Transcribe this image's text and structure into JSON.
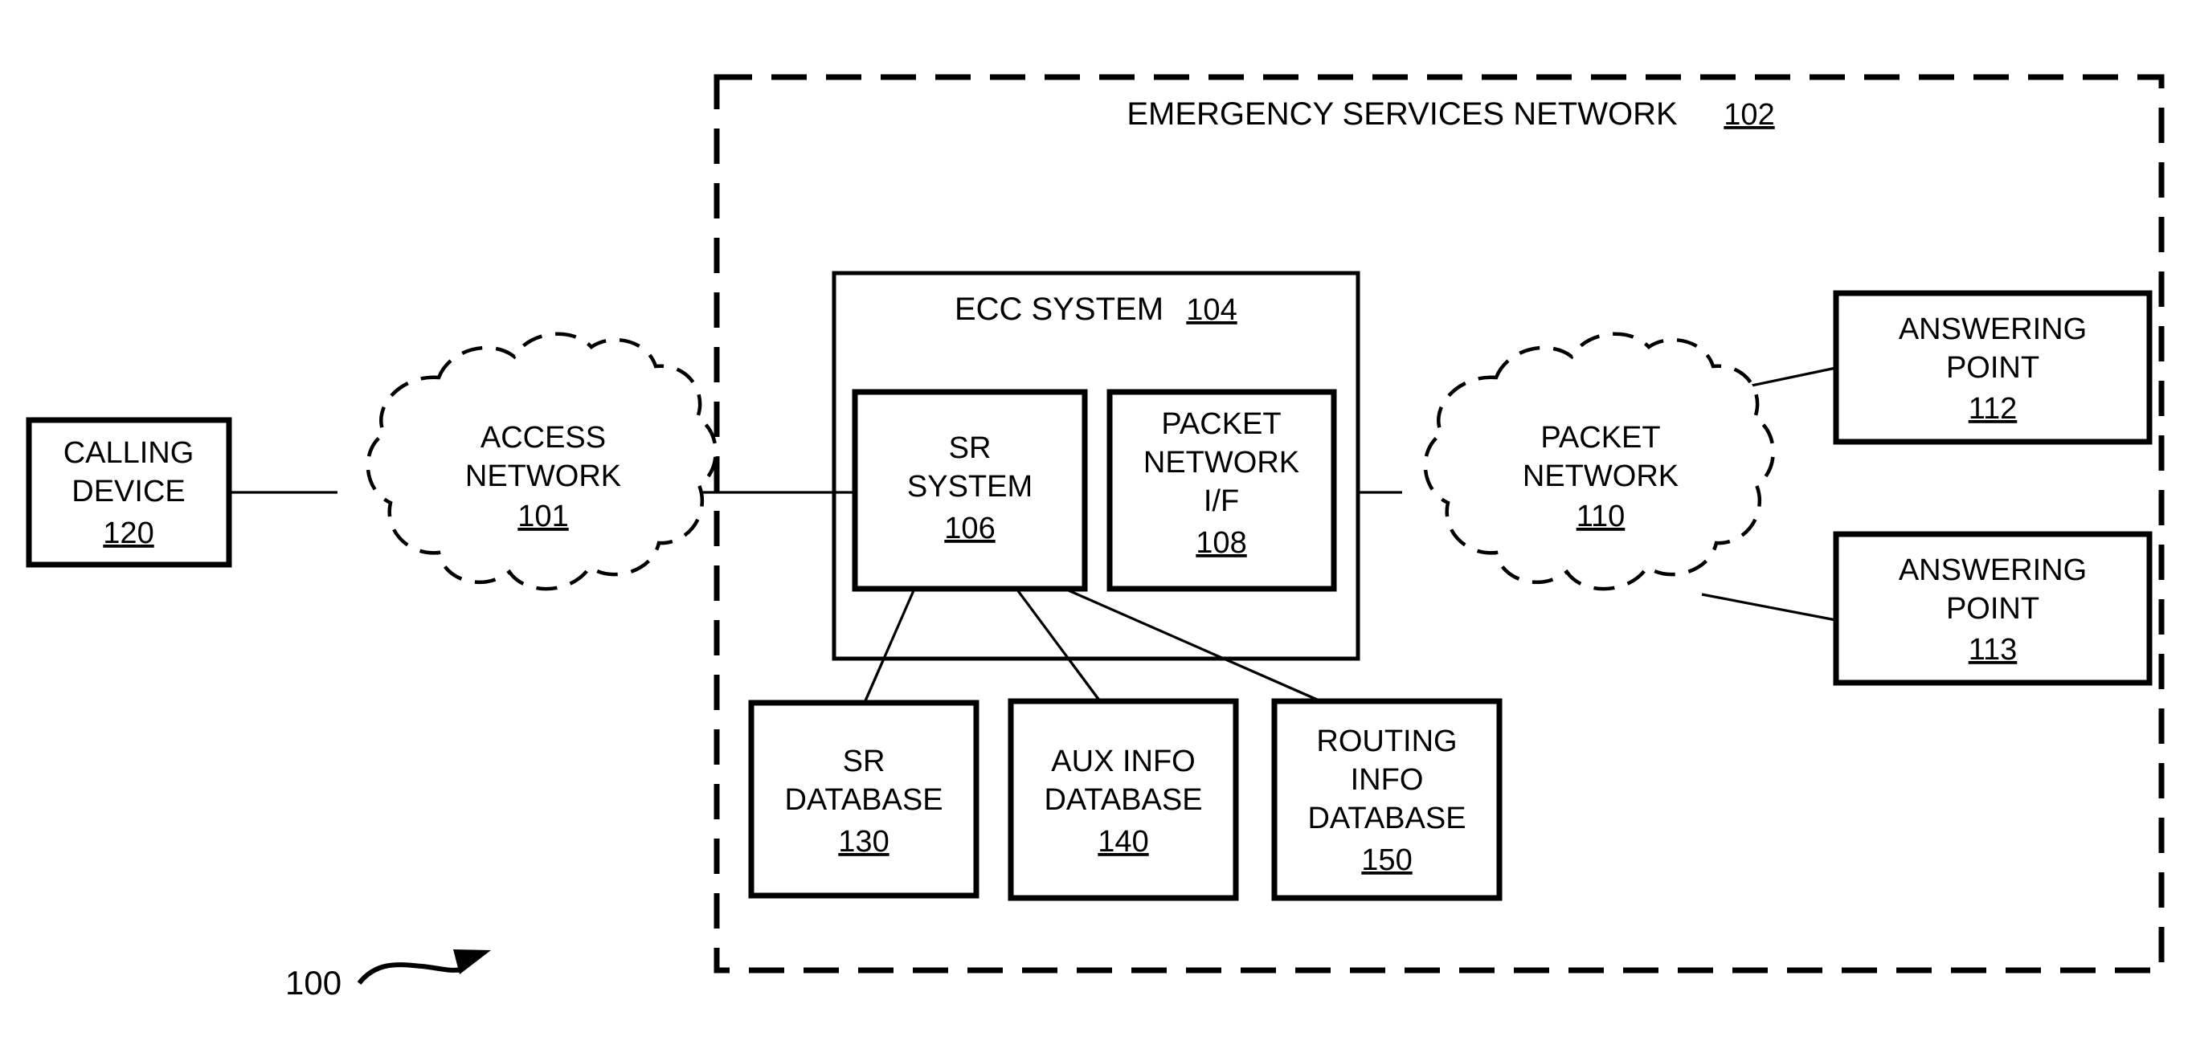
{
  "figure": {
    "number": "100",
    "type": "patent-diagram"
  },
  "outer_network": {
    "label": "EMERGENCY SERVICES NETWORK",
    "ref": "102",
    "border": "dashed"
  },
  "nodes": {
    "calling_device": {
      "lines": [
        "CALLING",
        "DEVICE"
      ],
      "ref": "120",
      "shape": "box"
    },
    "access_network": {
      "lines": [
        "ACCESS",
        "NETWORK"
      ],
      "ref": "101",
      "shape": "cloud"
    },
    "ecc_system": {
      "label": "ECC SYSTEM",
      "ref": "104",
      "shape": "box"
    },
    "sr_system": {
      "lines": [
        "SR",
        "SYSTEM"
      ],
      "ref": "106",
      "shape": "box"
    },
    "packet_network_if": {
      "lines": [
        "PACKET",
        "NETWORK",
        "I/F"
      ],
      "ref": "108",
      "shape": "box"
    },
    "packet_network": {
      "lines": [
        "PACKET",
        "NETWORK"
      ],
      "ref": "110",
      "shape": "cloud"
    },
    "answering_point_112": {
      "lines": [
        "ANSWERING",
        "POINT"
      ],
      "ref": "112",
      "shape": "box"
    },
    "answering_point_113": {
      "lines": [
        "ANSWERING",
        "POINT"
      ],
      "ref": "113",
      "shape": "box"
    },
    "sr_database": {
      "lines": [
        "SR",
        "DATABASE"
      ],
      "ref": "130",
      "shape": "box"
    },
    "aux_info_database": {
      "lines": [
        "AUX INFO",
        "DATABASE"
      ],
      "ref": "140",
      "shape": "box"
    },
    "routing_info_database": {
      "lines": [
        "ROUTING",
        "INFO",
        "DATABASE"
      ],
      "ref": "150",
      "shape": "box"
    }
  },
  "connections": [
    {
      "from": "calling_device",
      "to": "access_network"
    },
    {
      "from": "access_network",
      "to": "sr_system"
    },
    {
      "from": "sr_system",
      "to": "packet_network_if"
    },
    {
      "from": "packet_network_if",
      "to": "packet_network"
    },
    {
      "from": "packet_network",
      "to": "answering_point_112"
    },
    {
      "from": "packet_network",
      "to": "answering_point_113"
    },
    {
      "from": "sr_system",
      "to": "sr_database"
    },
    {
      "from": "sr_system",
      "to": "aux_info_database"
    },
    {
      "from": "sr_system",
      "to": "routing_info_database"
    }
  ],
  "colors": {
    "ink": "#000000",
    "paper": "#ffffff"
  }
}
